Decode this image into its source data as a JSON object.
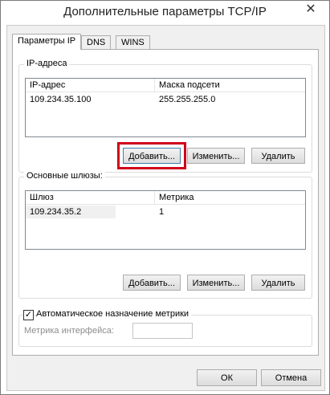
{
  "window": {
    "title": "Дополнительные параметры TCP/IP",
    "close_glyph": "✕"
  },
  "tabs": [
    {
      "label": "Параметры IP",
      "active": true
    },
    {
      "label": "DNS",
      "active": false
    },
    {
      "label": "WINS",
      "active": false
    }
  ],
  "ip_group": {
    "legend": "IP-адреса",
    "columns": [
      "IP-адрес",
      "Маска подсети"
    ],
    "rows": [
      [
        "109.234.35.100",
        "255.255.255.0"
      ]
    ],
    "buttons": {
      "add": "Добавить...",
      "edit": "Изменить...",
      "delete": "Удалить"
    }
  },
  "gateway_group": {
    "legend": "Основные шлюзы:",
    "columns": [
      "Шлюз",
      "Метрика"
    ],
    "rows": [
      [
        "109.234.35.2",
        "1"
      ]
    ],
    "buttons": {
      "add": "Добавить...",
      "edit": "Изменить...",
      "delete": "Удалить"
    }
  },
  "metric_group": {
    "auto_metric_label": "Автоматическое назначение метрики",
    "auto_metric_checked": true,
    "interface_metric_label": "Метрика интерфейса:",
    "interface_metric_value": ""
  },
  "footer": {
    "ok": "ОК",
    "cancel": "Отмена"
  },
  "colors": {
    "highlight": "#d0021b",
    "panel": "#f0f0f0"
  },
  "icons": {
    "close": "close-icon",
    "check": "checkmark-icon"
  }
}
